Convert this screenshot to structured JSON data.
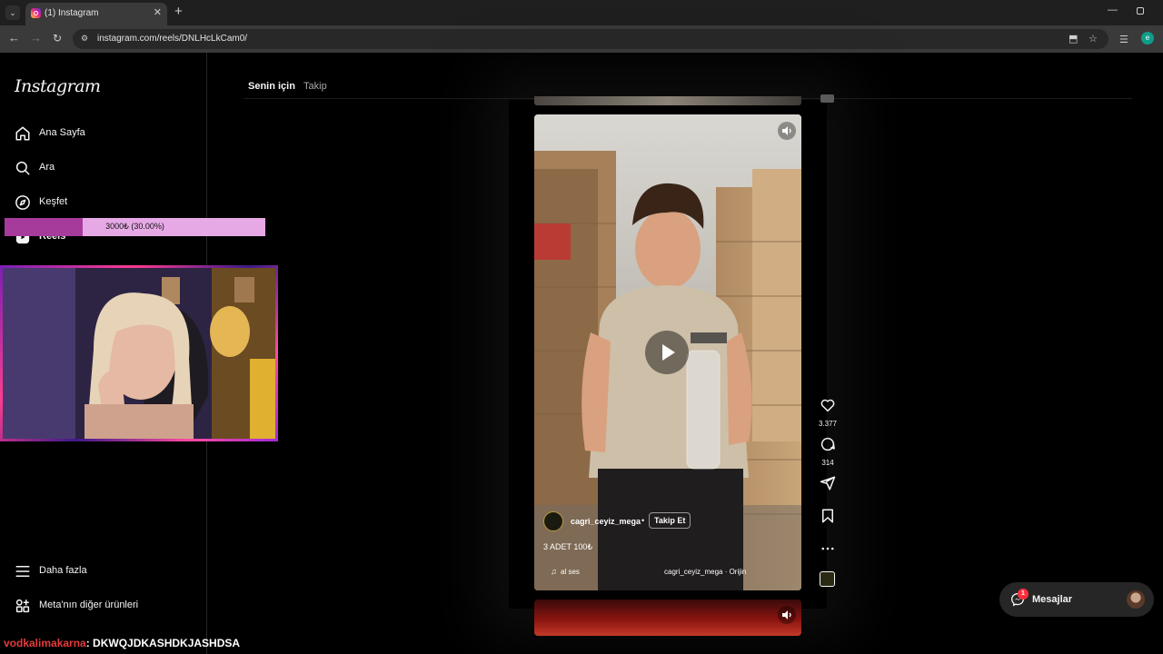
{
  "browser": {
    "tab_title": "(1) Instagram",
    "url": "instagram.com/reels/DNLHcLkCam0/",
    "profile_initial": "e"
  },
  "sidebar": {
    "logo": "Instagram",
    "items": [
      {
        "label": "Ana Sayfa",
        "icon": "home-icon"
      },
      {
        "label": "Ara",
        "icon": "search-icon"
      },
      {
        "label": "Keşfet",
        "icon": "compass-icon"
      },
      {
        "label": "Reels",
        "icon": "reels-icon"
      }
    ],
    "bottom_items": [
      {
        "label": "Daha fazla",
        "icon": "menu-icon"
      },
      {
        "label": "Meta'nın diğer ürünleri",
        "icon": "meta-apps-icon"
      }
    ]
  },
  "feed": {
    "tabs": [
      "Senin için",
      "Takip"
    ],
    "active_tab": 0
  },
  "reel": {
    "username": "cagri_ceyiz_mega",
    "follow_label": "Takip Et",
    "caption": "3 ADET 100₺",
    "audio_label": "al ses",
    "audio_source": "cagri_ceyiz_mega · Orijin",
    "likes": "3.377",
    "comments": "314"
  },
  "overlay": {
    "progress_text": "3000₺ (30.00%)",
    "progress_fraction": 0.3,
    "chat_user": "vodkalimakarna",
    "chat_message": ": DKWQJDKASHDKJASHDSA"
  },
  "messages": {
    "label": "Mesajlar",
    "badge": "1"
  },
  "colors": {
    "accent_progress": "#a63b9b",
    "progress_bg": "#e7a9e6",
    "notification": "#ff3040",
    "chat_user": "#e43b3b"
  }
}
